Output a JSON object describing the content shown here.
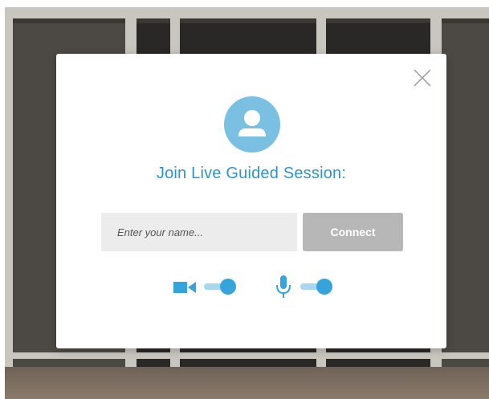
{
  "modal": {
    "title": "Join Live Guided Session:",
    "name_input": {
      "value": "",
      "placeholder": "Enter your name..."
    },
    "connect_label": "Connect",
    "camera_toggle": {
      "icon": "video-camera-icon",
      "on": true
    },
    "microphone_toggle": {
      "icon": "microphone-icon",
      "on": true
    },
    "close_icon": "close-icon",
    "avatar_icon": "user-avatar-icon"
  },
  "colors": {
    "accent": "#35a4da",
    "accent_light": "#79c0e3",
    "title": "#2e95c9",
    "button_disabled": "#b7b7b7",
    "input_bg": "#ececec"
  }
}
